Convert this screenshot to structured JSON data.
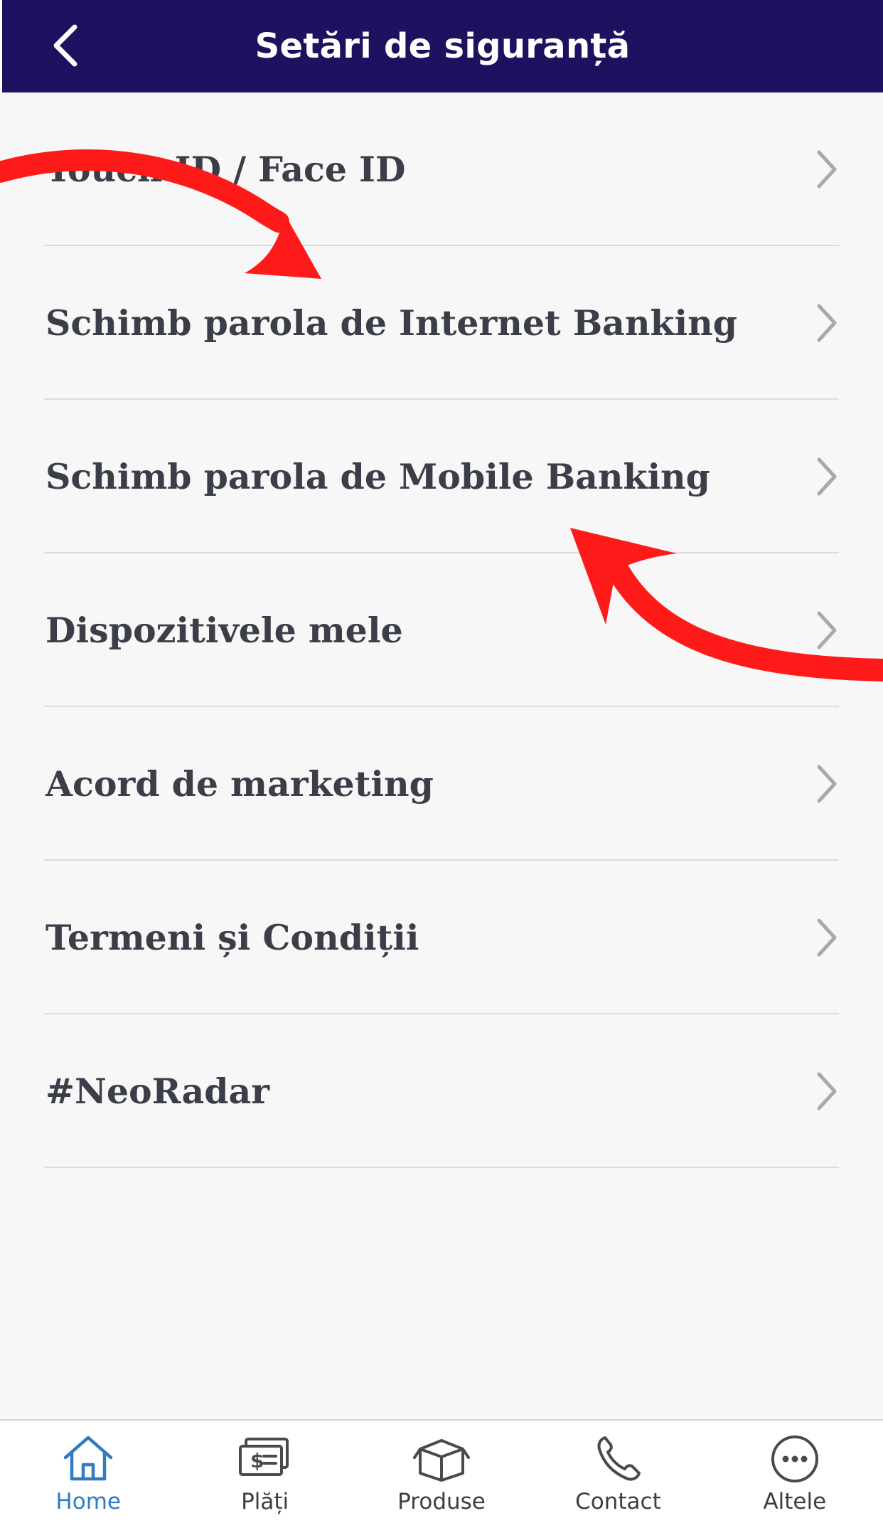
{
  "header": {
    "title": "Setări de siguranță",
    "back_icon": "chevron-left-icon"
  },
  "menu": {
    "items": [
      {
        "label": "Touch ID / Face ID"
      },
      {
        "label": "Schimb parola de Internet Banking"
      },
      {
        "label": "Schimb parola de Mobile Banking"
      },
      {
        "label": "Dispozitivele mele"
      },
      {
        "label": "Acord de marketing"
      },
      {
        "label": "Termeni și Condiții"
      },
      {
        "label": "#NeoRadar"
      }
    ],
    "chevron_icon": "chevron-right-icon"
  },
  "tabbar": {
    "items": [
      {
        "label": "Home",
        "icon": "home-icon",
        "active": true
      },
      {
        "label": "Plăți",
        "icon": "payments-icon",
        "active": false
      },
      {
        "label": "Produse",
        "icon": "box-icon",
        "active": false
      },
      {
        "label": "Contact",
        "icon": "phone-icon",
        "active": false
      },
      {
        "label": "Altele",
        "icon": "more-icon",
        "active": false
      }
    ]
  },
  "colors": {
    "header_bg": "#1c1260",
    "item_text": "#3b3e48",
    "active_tab": "#2f7bc4",
    "annotation_arrow": "#ff1a1a"
  }
}
